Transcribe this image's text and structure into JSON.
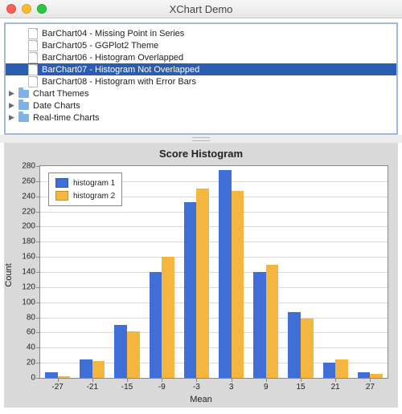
{
  "window": {
    "title": "XChart Demo"
  },
  "tree": {
    "items": [
      {
        "label": "BarChart04 - Missing Point in Series"
      },
      {
        "label": "BarChart05 - GGPlot2 Theme"
      },
      {
        "label": "BarChart06 - Histogram Overlapped"
      },
      {
        "label": "BarChart07 - Histogram Not Overlapped"
      },
      {
        "label": "BarChart08 - Histogram with Error Bars"
      }
    ],
    "folders": [
      {
        "label": "Chart Themes"
      },
      {
        "label": "Date Charts"
      },
      {
        "label": "Real-time Charts"
      }
    ]
  },
  "chart_data": {
    "type": "bar",
    "title": "Score Histogram",
    "xlabel": "Mean",
    "ylabel": "Count",
    "ylim": [
      0,
      280
    ],
    "yticks": [
      0,
      20,
      40,
      60,
      80,
      100,
      120,
      140,
      160,
      180,
      200,
      220,
      240,
      260,
      280
    ],
    "categories": [
      -27,
      -21,
      -15,
      -9,
      -3,
      3,
      9,
      15,
      21,
      27
    ],
    "series": [
      {
        "name": "histogram 1",
        "color": "#3f6fd6",
        "values": [
          7,
          24,
          70,
          140,
          232,
          275,
          140,
          87,
          20,
          7
        ]
      },
      {
        "name": "histogram 2",
        "color": "#f4b63f",
        "values": [
          2,
          22,
          62,
          160,
          250,
          247,
          150,
          78,
          24,
          5
        ]
      }
    ],
    "legend_position": {
      "left": 10,
      "top": 8
    }
  }
}
